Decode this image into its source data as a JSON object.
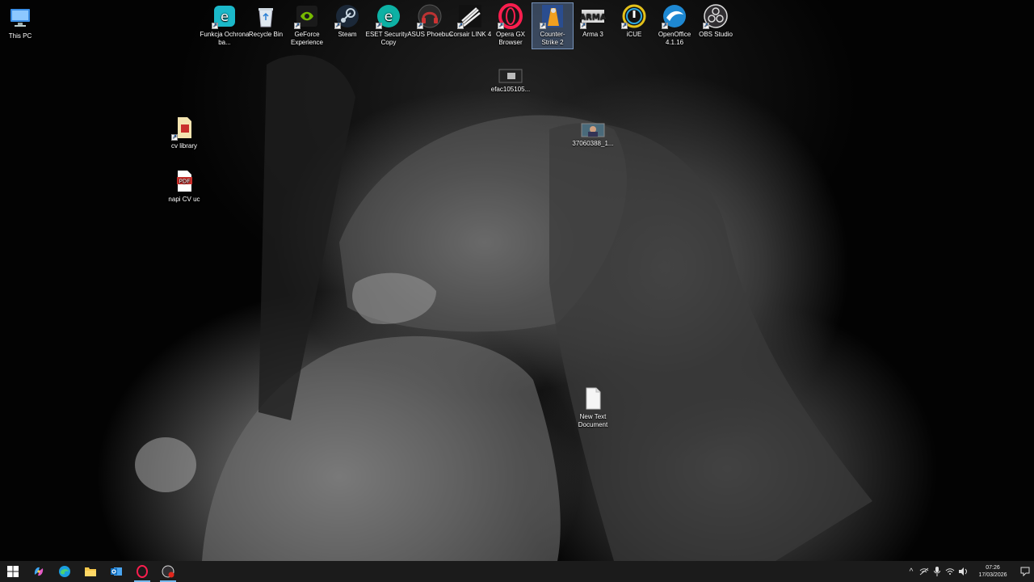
{
  "desktop": {
    "icons": [
      {
        "label": "This PC"
      },
      {
        "label": "Funkcja Ochrona ba..."
      },
      {
        "label": "Recycle Bin"
      },
      {
        "label": "GeForce Experience"
      },
      {
        "label": "Steam"
      },
      {
        "label": "ESET Security - Copy"
      },
      {
        "label": "ASUS Phoebus"
      },
      {
        "label": "Corsair LINK 4"
      },
      {
        "label": "Opera GX Browser"
      },
      {
        "label": "Counter-Strike 2"
      },
      {
        "label": "Arma 3"
      },
      {
        "label": "iCUE"
      },
      {
        "label": "OpenOffice 4.1.16"
      },
      {
        "label": "OBS Studio"
      },
      {
        "label": "efac105105..."
      },
      {
        "label": "37060388_1..."
      },
      {
        "label": "cv library"
      },
      {
        "label": "napi CV uc"
      },
      {
        "label": "New Text Document"
      }
    ]
  },
  "taskbar": {
    "apps": [
      "start",
      "copilot",
      "edge",
      "file-explorer",
      "outlook",
      "opera-gx",
      "obs"
    ]
  },
  "tray": {
    "time": "07:26",
    "date": "17/03/2026"
  },
  "colors": {
    "taskbar": "#1b1b1b",
    "selection": "#78a0dc",
    "accent": "#76b9ed"
  }
}
